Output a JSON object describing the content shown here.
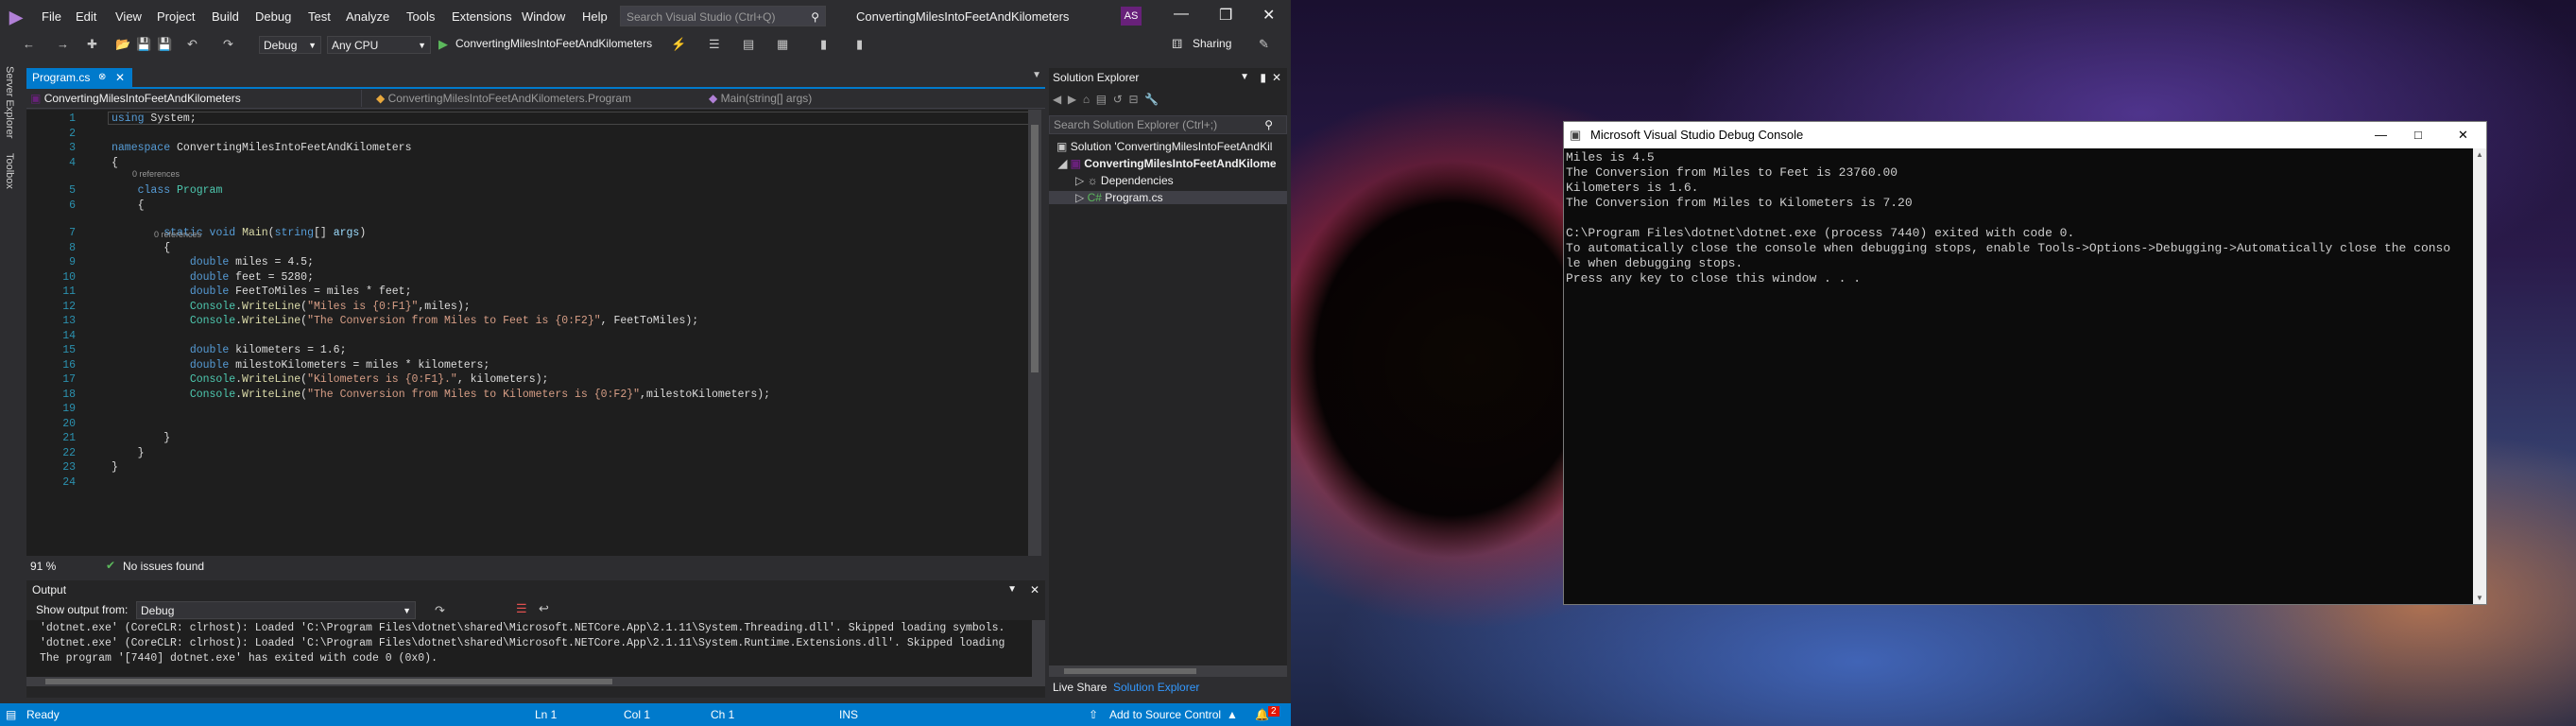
{
  "window": {
    "title": "ConvertingMilesIntoFeetAndKilometers",
    "menu": [
      "File",
      "Edit",
      "View",
      "Project",
      "Build",
      "Debug",
      "Test",
      "Analyze",
      "Tools",
      "Extensions",
      "Window",
      "Help"
    ],
    "search_placeholder": "Search Visual Studio (Ctrl+Q)",
    "avatar": "AS",
    "sharing": "Sharing"
  },
  "toolbar": {
    "config": "Debug",
    "platform": "Any CPU",
    "run_target": "ConvertingMilesIntoFeetAndKilometers"
  },
  "side_strip": [
    "Server Explorer",
    "Toolbox"
  ],
  "editor": {
    "tab": "Program.cs",
    "nav_project": "ConvertingMilesIntoFeetAndKilometers",
    "nav_class": "ConvertingMilesIntoFeetAndKilometers.Program",
    "nav_member": "Main(string[] args)",
    "line_numbers": [
      "1",
      "2",
      "3",
      "4",
      "5",
      "6",
      "7",
      "8",
      "9",
      "10",
      "11",
      "12",
      "13",
      "14",
      "15",
      "16",
      "17",
      "18",
      "19",
      "20",
      "21",
      "22",
      "23",
      "24"
    ],
    "code_lines": [
      "using System;",
      "",
      "namespace ConvertingMilesIntoFeetAndKilometers",
      "{",
      "    class Program",
      "    {",
      "        static void Main(string[] args)",
      "        {",
      "            double miles = 4.5;",
      "            double feet = 5280;",
      "            double FeetToMiles = miles * feet;",
      "            Console.WriteLine(\"Miles is {0:F1}\",miles);",
      "            Console.WriteLine(\"The Conversion from Miles to Feet is {0:F2}\", FeetToMiles);",
      "",
      "            double kilometers = 1.6;",
      "            double milestoKilometers = miles * kilometers;",
      "            Console.WriteLine(\"Kilometers is {0:F1}.\", kilometers);",
      "            Console.WriteLine(\"The Conversion from Miles to Kilometers is {0:F2}\",milestoKilometers);",
      "",
      "",
      "        }",
      "    }",
      "}",
      ""
    ],
    "references_label": "0 references",
    "zoom": "91 %",
    "issues": "No issues found"
  },
  "output": {
    "title": "Output",
    "show_from_label": "Show output from:",
    "show_from_value": "Debug",
    "lines": [
      "'dotnet.exe' (CoreCLR: clrhost): Loaded 'C:\\Program Files\\dotnet\\shared\\Microsoft.NETCore.App\\2.1.11\\System.Threading.dll'. Skipped loading symbols.",
      "'dotnet.exe' (CoreCLR: clrhost): Loaded 'C:\\Program Files\\dotnet\\shared\\Microsoft.NETCore.App\\2.1.11\\System.Runtime.Extensions.dll'. Skipped loading",
      "The program '[7440] dotnet.exe' has exited with code 0 (0x0)."
    ]
  },
  "solution_explorer": {
    "title": "Solution Explorer",
    "search_placeholder": "Search Solution Explorer (Ctrl+;)",
    "items": [
      "Solution 'ConvertingMilesIntoFeetAndKil",
      "ConvertingMilesIntoFeetAndKilome",
      "Dependencies",
      "Program.cs"
    ],
    "tab_live_share": "Live Share",
    "tab_solution_explorer": "Solution Explorer"
  },
  "status_bar": {
    "ready": "Ready",
    "ln": "Ln 1",
    "col": "Col 1",
    "ch": "Ch 1",
    "ins": "INS",
    "source_control": "Add to Source Control",
    "notifications": "2"
  },
  "console": {
    "title": "Microsoft Visual Studio Debug Console",
    "lines": [
      "Miles is 4.5",
      "The Conversion from Miles to Feet is 23760.00",
      "Kilometers is 1.6.",
      "The Conversion from Miles to Kilometers is 7.20",
      "",
      "C:\\Program Files\\dotnet\\dotnet.exe (process 7440) exited with code 0.",
      "To automatically close the console when debugging stops, enable Tools->Options->Debugging->Automatically close the conso",
      "le when debugging stops.",
      "Press any key to close this window . . ."
    ]
  },
  "colors": {
    "accent": "#007acc",
    "keyword": "#569cd6",
    "type": "#4ec9b0",
    "string": "#d69d85",
    "method": "#dcdcaa",
    "variable": "#9cdcfe"
  }
}
